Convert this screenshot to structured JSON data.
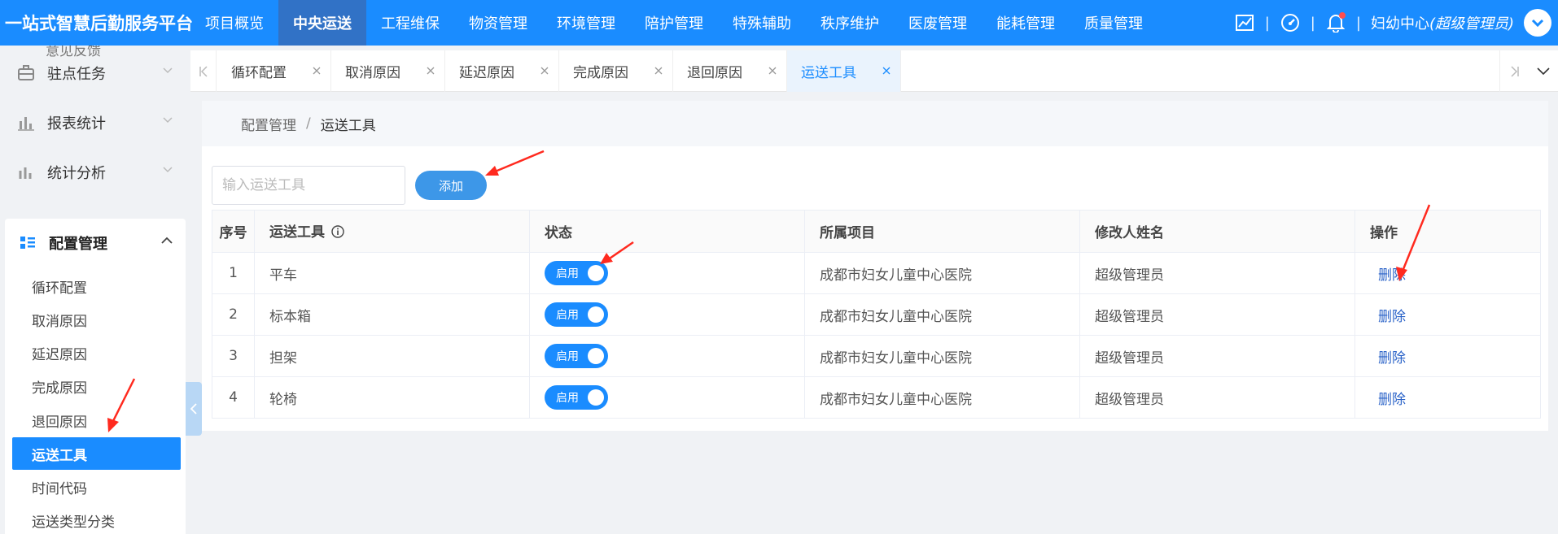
{
  "app": {
    "title": "一站式智慧后勤服务平台",
    "nav": [
      "项目概览",
      "中央运送",
      "工程维保",
      "物资管理",
      "环境管理",
      "陪护管理",
      "特殊辅助",
      "秩序维护",
      "医废管理",
      "能耗管理",
      "质量管理"
    ],
    "active_nav": "中央运送",
    "user": {
      "org": "妇幼中心",
      "role": "(超级管理员)"
    },
    "colors": {
      "primary": "#1a8cff",
      "nav_active": "#3172c6",
      "annotation": "#ff2a1f"
    }
  },
  "sidebar": {
    "partial_item": "意见反馈",
    "menus": [
      {
        "label": "驻点任务",
        "icon": "briefcase-icon"
      },
      {
        "label": "报表统计",
        "icon": "bar-chart-icon"
      },
      {
        "label": "统计分析",
        "icon": "analytics-icon"
      }
    ],
    "group": {
      "label": "配置管理",
      "icon": "config-grid-icon",
      "items": [
        "循环配置",
        "取消原因",
        "延迟原因",
        "完成原因",
        "退回原因",
        "运送工具",
        "时间代码",
        "运送类型分类"
      ],
      "active": "运送工具"
    }
  },
  "tabs": {
    "items": [
      "循环配置",
      "取消原因",
      "延迟原因",
      "完成原因",
      "退回原因",
      "运送工具"
    ],
    "active": "运送工具"
  },
  "breadcrumb": {
    "parent": "配置管理",
    "separator": "/",
    "current": "运送工具"
  },
  "toolbar": {
    "search_placeholder": "输入运送工具",
    "add_label": "添加"
  },
  "table": {
    "headers": {
      "seq": "序号",
      "tool": "运送工具",
      "status": "状态",
      "project": "所属项目",
      "modifier": "修改人姓名",
      "ops": "操作"
    },
    "rows": [
      {
        "seq": "1",
        "tool": "平车",
        "status": "启用",
        "project": "成都市妇女儿童中心医院",
        "modifier": "超级管理员",
        "op": "删除"
      },
      {
        "seq": "2",
        "tool": "标本箱",
        "status": "启用",
        "project": "成都市妇女儿童中心医院",
        "modifier": "超级管理员",
        "op": "删除"
      },
      {
        "seq": "3",
        "tool": "担架",
        "status": "启用",
        "project": "成都市妇女儿童中心医院",
        "modifier": "超级管理员",
        "op": "删除"
      },
      {
        "seq": "4",
        "tool": "轮椅",
        "status": "启用",
        "project": "成都市妇女儿童中心医院",
        "modifier": "超级管理员",
        "op": "删除"
      }
    ]
  }
}
